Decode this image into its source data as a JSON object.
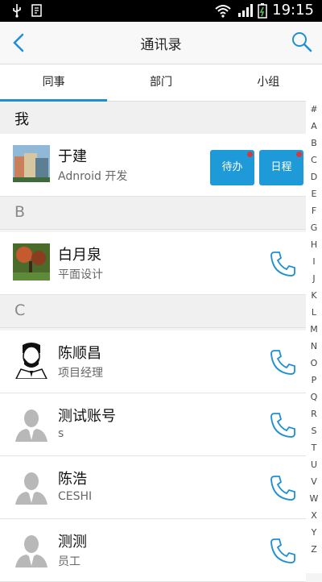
{
  "status": {
    "time": "19:15"
  },
  "header": {
    "title": "通讯录"
  },
  "tabs": [
    "同事",
    "部门",
    "小组"
  ],
  "sections": {
    "me": "我",
    "b": "B",
    "c": "C"
  },
  "rows": [
    {
      "name": "于建",
      "sub": "Adnroid 开发",
      "buttons": [
        "待办",
        "日程"
      ]
    },
    {
      "name": "白月泉",
      "sub": "平面设计"
    },
    {
      "name": "陈顺昌",
      "sub": "项目经理"
    },
    {
      "name": "测试账号",
      "sub": "s"
    },
    {
      "name": "陈浩",
      "sub": "CESHI"
    },
    {
      "name": "测测",
      "sub": "员工"
    }
  ],
  "index_letters": [
    "#",
    "A",
    "B",
    "C",
    "D",
    "E",
    "F",
    "G",
    "H",
    "I",
    "J",
    "K",
    "L",
    "M",
    "N",
    "O",
    "P",
    "Q",
    "R",
    "S",
    "T",
    "U",
    "V",
    "W",
    "X",
    "Y",
    "Z"
  ]
}
